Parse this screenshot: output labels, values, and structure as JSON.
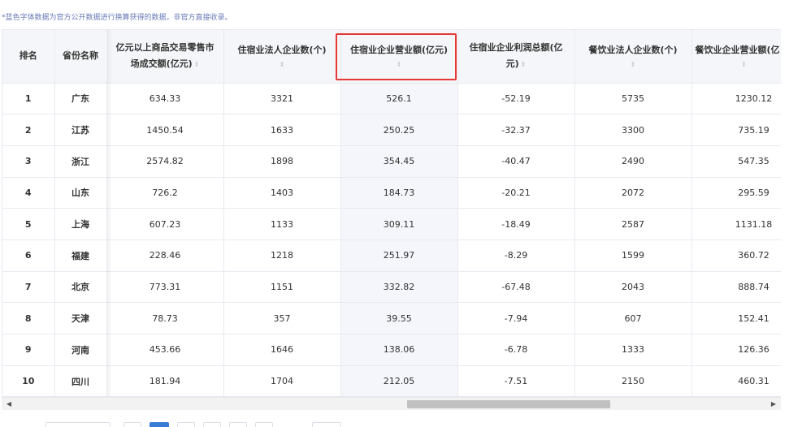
{
  "note": "*蓝色字体数据为官方公开数据进行换算获得的数据，非官方直接收录。",
  "columns": [
    {
      "label": "排名"
    },
    {
      "label": "省份名称"
    },
    {
      "label": "亿元以上商品交易零售市场成交额(亿元)",
      "line1": "亿元以上商品交易零售市",
      "line2": "场成交额(亿元)"
    },
    {
      "label": "住宿业法人企业数(个)"
    },
    {
      "label": "住宿业企业营业额(亿元)"
    },
    {
      "label": "住宿业企业利润总额(亿元)",
      "line1": "住宿业企业利润总额(亿",
      "line2": "元)"
    },
    {
      "label": "餐饮业法人企业数(个)"
    },
    {
      "label": "餐饮业企业营业额(亿元)",
      "visible": "餐饮业企业营业额(亿"
    }
  ],
  "sort_icon": "⇕",
  "rows": [
    {
      "rank": "1",
      "province": "广东",
      "market": "634.33",
      "hotel_count": "3321",
      "hotel_revenue": "526.1",
      "hotel_profit": "-52.19",
      "food_count": "5735",
      "food_revenue": "1230.12"
    },
    {
      "rank": "2",
      "province": "江苏",
      "market": "1450.54",
      "hotel_count": "1633",
      "hotel_revenue": "250.25",
      "hotel_profit": "-32.37",
      "food_count": "3300",
      "food_revenue": "735.19"
    },
    {
      "rank": "3",
      "province": "浙江",
      "market": "2574.82",
      "hotel_count": "1898",
      "hotel_revenue": "354.45",
      "hotel_profit": "-40.47",
      "food_count": "2490",
      "food_revenue": "547.35"
    },
    {
      "rank": "4",
      "province": "山东",
      "market": "726.2",
      "hotel_count": "1403",
      "hotel_revenue": "184.73",
      "hotel_profit": "-20.21",
      "food_count": "2072",
      "food_revenue": "295.59"
    },
    {
      "rank": "5",
      "province": "上海",
      "market": "607.23",
      "hotel_count": "1133",
      "hotel_revenue": "309.11",
      "hotel_profit": "-18.49",
      "food_count": "2587",
      "food_revenue": "1131.18"
    },
    {
      "rank": "6",
      "province": "福建",
      "market": "228.46",
      "hotel_count": "1218",
      "hotel_revenue": "251.97",
      "hotel_profit": "-8.29",
      "food_count": "1599",
      "food_revenue": "360.72"
    },
    {
      "rank": "7",
      "province": "北京",
      "market": "773.31",
      "hotel_count": "1151",
      "hotel_revenue": "332.82",
      "hotel_profit": "-67.48",
      "food_count": "2043",
      "food_revenue": "888.74"
    },
    {
      "rank": "8",
      "province": "天津",
      "market": "78.73",
      "hotel_count": "357",
      "hotel_revenue": "39.55",
      "hotel_profit": "-7.94",
      "food_count": "607",
      "food_revenue": "152.41"
    },
    {
      "rank": "9",
      "province": "河南",
      "market": "453.66",
      "hotel_count": "1646",
      "hotel_revenue": "138.06",
      "hotel_profit": "-6.78",
      "food_count": "1333",
      "food_revenue": "126.36"
    },
    {
      "rank": "10",
      "province": "四川",
      "market": "181.94",
      "hotel_count": "1704",
      "hotel_revenue": "212.05",
      "hotel_profit": "-7.51",
      "food_count": "2150",
      "food_revenue": "460.31"
    }
  ],
  "scrollbar": {
    "left_arrow": "◀",
    "right_arrow": "▶"
  },
  "colors": {
    "highlight_border": "#e53935",
    "note_text": "#6b7ab8",
    "header_bg": "#f5f6f9"
  }
}
